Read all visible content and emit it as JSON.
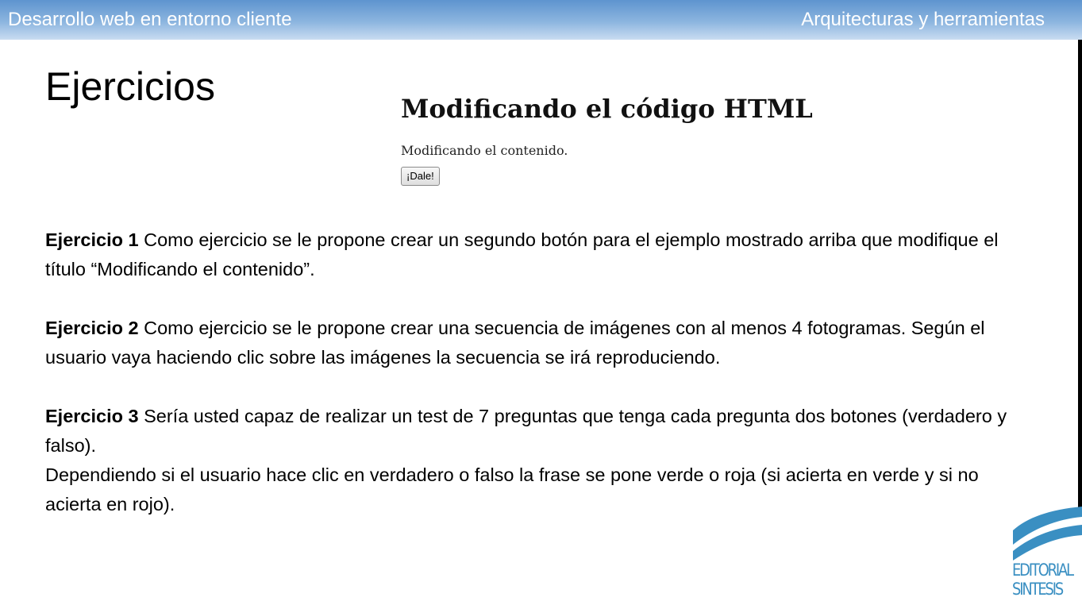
{
  "header": {
    "left": "Desarrollo web en entorno cliente",
    "right": "Arquitecturas y herramientas"
  },
  "slide": {
    "title": "Ejercicios"
  },
  "demo": {
    "heading": "Modificando el código HTML",
    "text": "Modificando el contenido.",
    "button_label": "¡Dale!"
  },
  "exercises": [
    {
      "label": "Ejercicio 1",
      "paragraphs": [
        " Como ejercicio se le propone crear un segundo botón para el ejemplo mostrado arriba que modifique el título “Modificando el contenido”."
      ]
    },
    {
      "label": "Ejercicio 2",
      "paragraphs": [
        " Como ejercicio se le propone crear una secuencia de imágenes con al menos 4 fotogramas. Según el usuario vaya haciendo clic sobre las imágenes la secuencia se irá reproduciendo."
      ]
    },
    {
      "label": "Ejercicio 3",
      "paragraphs": [
        " Sería usted capaz de realizar un test de 7 preguntas que tenga cada pregunta dos botones (verdadero y falso).",
        "Dependiendo si el usuario hace clic en verdadero o falso la frase se pone verde o roja (si acierta en verde y si no acierta en rojo)."
      ]
    }
  ],
  "logo": {
    "line1": "EDITORIAL",
    "line2": "SINTESIS",
    "color": "#3a8fc2"
  },
  "colors": {
    "header_gradient_top": "#5e94cf",
    "header_gradient_bottom": "#c9dcf1"
  }
}
